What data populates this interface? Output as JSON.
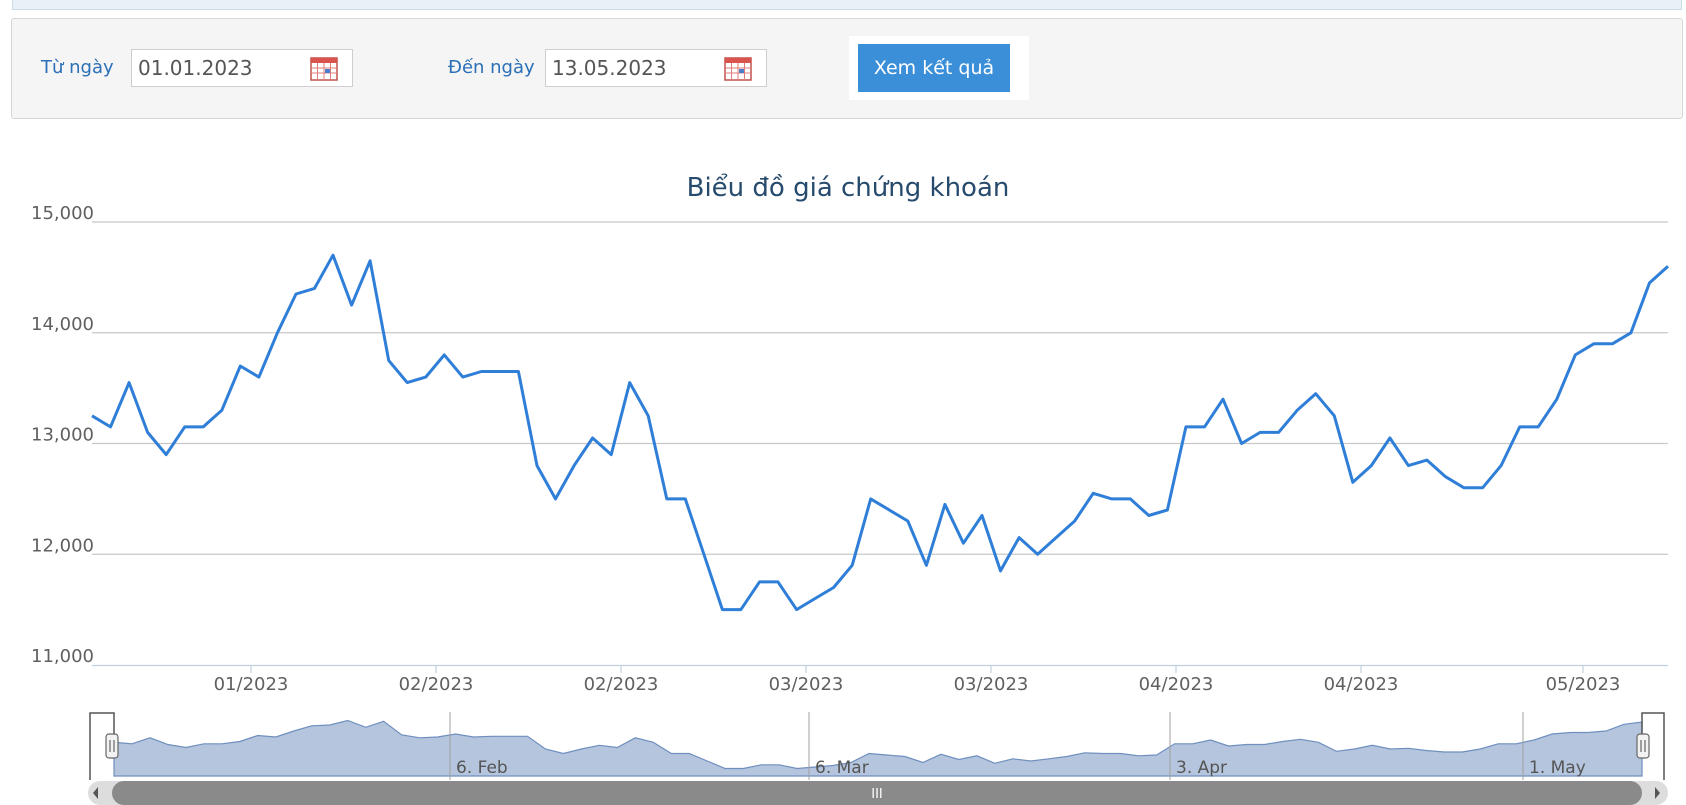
{
  "filter": {
    "from_label": "Từ ngày",
    "from_value": "01.01.2023",
    "to_label": "Đến ngày",
    "to_value": "13.05.2023",
    "submit_label": "Xem kết quả"
  },
  "colors": {
    "line": "#2f7ed8",
    "accent": "#3b8fd8",
    "navigator_fill": "#b4c5dd",
    "label": "#2a6fb7"
  },
  "navigator": {
    "labels": [
      "6. Feb",
      "6. Mar",
      "3. Apr",
      "1. May"
    ],
    "scroll_grip": "III"
  },
  "chart_data": {
    "type": "line",
    "title": "Biểu đồ giá chứng khoán",
    "ylim": [
      11000,
      15000
    ],
    "yticks": [
      11000,
      12000,
      13000,
      14000,
      15000
    ],
    "ytick_labels": [
      "11,000",
      "12,000",
      "13,000",
      "14,000",
      "15,000"
    ],
    "xtick_labels": [
      "01/2023",
      "02/2023",
      "02/2023",
      "03/2023",
      "03/2023",
      "04/2023",
      "04/2023",
      "05/2023"
    ],
    "grid": true,
    "series": [
      {
        "values": [
          13250,
          13150,
          13550,
          13100,
          12900,
          13150,
          13150,
          13300,
          13700,
          13600,
          14000,
          14350,
          14400,
          14700,
          14250,
          14650,
          13750,
          13550,
          13600,
          13800,
          13600,
          13650,
          13650,
          13650,
          12800,
          12500,
          12800,
          13050,
          12900,
          13550,
          13250,
          12500,
          12500,
          12000,
          11500,
          11500,
          11750,
          11750,
          11500,
          11600,
          11700,
          11900,
          12500,
          12400,
          12300,
          11900,
          12450,
          12100,
          12350,
          11850,
          12150,
          12000,
          12150,
          12300,
          12550,
          12500,
          12500,
          12350,
          12400,
          13150,
          13150,
          13400,
          13000,
          13100,
          13100,
          13300,
          13450,
          13250,
          12650,
          12800,
          13050,
          12800,
          12850,
          12700,
          12600,
          12600,
          12800,
          13150,
          13150,
          13400,
          13800,
          13900,
          13900,
          14000,
          14450,
          14600
        ]
      }
    ]
  }
}
